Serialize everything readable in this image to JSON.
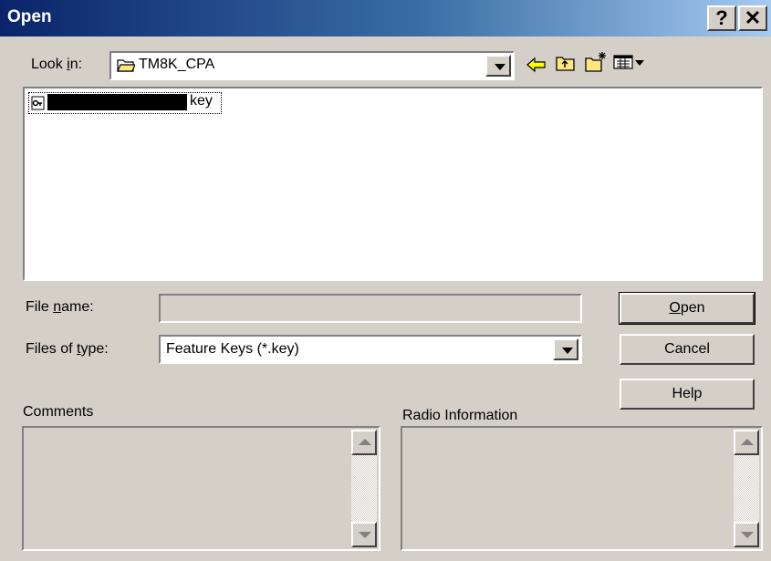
{
  "window": {
    "title": "Open",
    "help_glyph": "?",
    "close_glyph": "✕"
  },
  "lookin": {
    "label_pre": "Look ",
    "label_key": "i",
    "label_post": "n:",
    "value": "TM8K_CPA"
  },
  "files": [
    {
      "name": "key",
      "icon": "key-file-icon"
    }
  ],
  "filename": {
    "label_pre": "File ",
    "label_key": "n",
    "label_post": "ame:",
    "value": ""
  },
  "filetype": {
    "label_pre": "Files of ",
    "label_key": "t",
    "label_post": "ype:",
    "value": "Feature Keys (*.key)"
  },
  "buttons": {
    "open_key": "O",
    "open_rest": "pen",
    "cancel": "Cancel",
    "help": "Help"
  },
  "sections": {
    "comments": "Comments",
    "radio": "Radio Information"
  },
  "colors": {
    "title_start": "#0a246a",
    "title_end": "#a6caf0",
    "face": "#d4d0c8"
  }
}
